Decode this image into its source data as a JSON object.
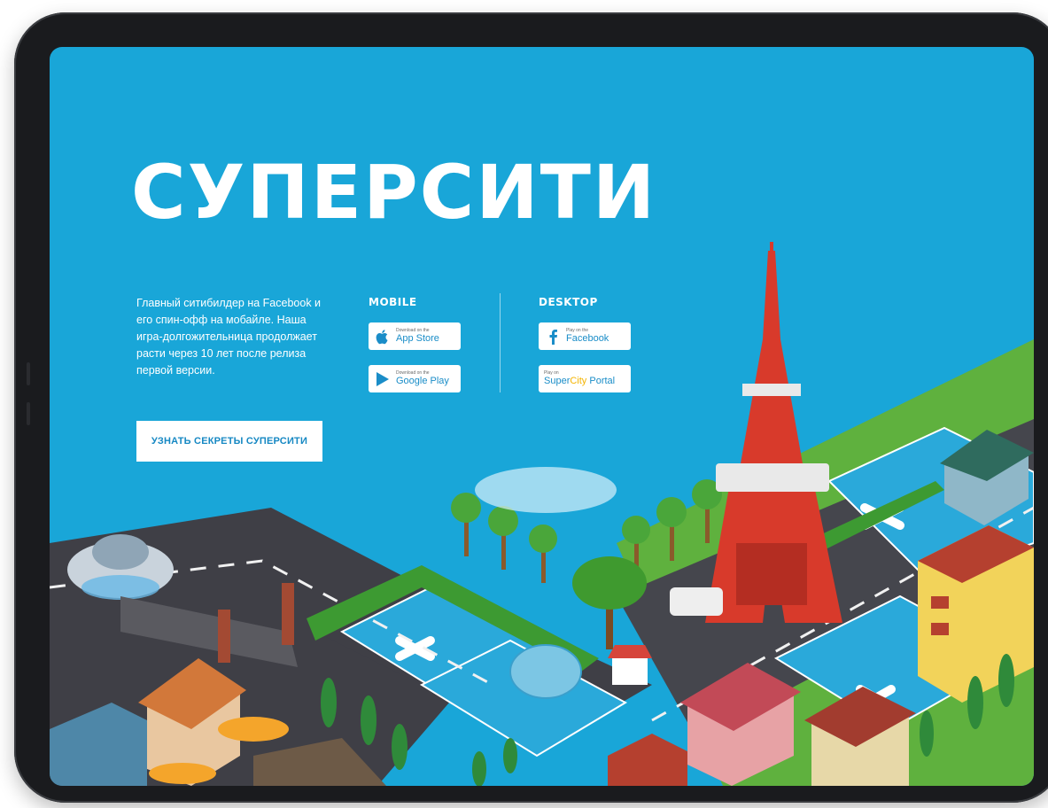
{
  "hero": {
    "title": "СУПЕРСИТИ",
    "description": "Главный ситибилдер на Facebook и его спин-офф на мобайле. Наша игра-долгожительница продолжает расти через 10 лет после релиза первой версии.",
    "cta_label": "УЗНАТЬ СЕКРЕТЫ СУПЕРСИТИ"
  },
  "mobile": {
    "heading": "MOBILE",
    "app_store": {
      "small": "Download on the",
      "big": "App Store",
      "icon": "apple-icon"
    },
    "google_play": {
      "small": "Download on the",
      "big": "Google Play",
      "icon": "play-icon"
    }
  },
  "desktop": {
    "heading": "DESKTOP",
    "facebook": {
      "small": "Play on the",
      "big": "Facebook",
      "icon": "facebook-icon"
    },
    "portal": {
      "small": "Play on",
      "big_a": "Super",
      "big_b": "City",
      "big_c": " Portal"
    }
  },
  "colors": {
    "background": "#19a6d8",
    "accent": "#1688c3",
    "portal_highlight": "#f4b400"
  }
}
